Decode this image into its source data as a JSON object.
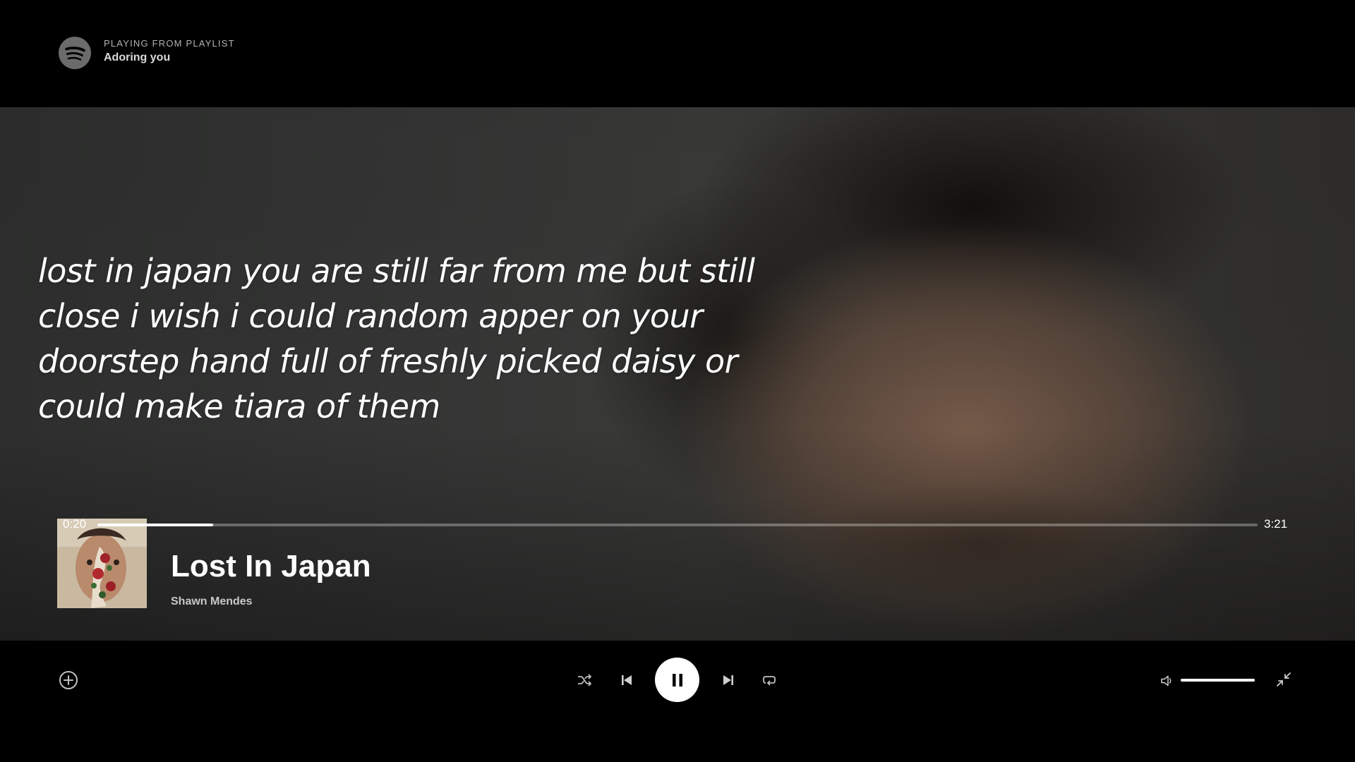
{
  "header": {
    "context_label": "PLAYING FROM PLAYLIST",
    "playlist_name": "Adoring you",
    "logo_icon": "spotify-logo-icon"
  },
  "lyrics": {
    "text": "lost in japan you are still far from me but still close i wish i could random apper on your doorstep hand full of freshly picked daisy or could make tiara of them"
  },
  "track": {
    "title": "Lost In Japan",
    "artist": "Shawn Mendes",
    "album_art_icon": "album-cover"
  },
  "progress": {
    "current": "0:20",
    "total": "3:21",
    "fraction": 0.1
  },
  "controls": {
    "add_icon": "plus-circle-icon",
    "shuffle_icon": "shuffle-icon",
    "previous_icon": "skip-previous-icon",
    "play_pause_icon": "pause-icon",
    "next_icon": "skip-next-icon",
    "repeat_icon": "repeat-icon",
    "volume_icon": "volume-icon",
    "volume_level": 1.0,
    "fullscreen_icon": "minimize-icon"
  },
  "colors": {
    "background": "#000000",
    "text_primary": "#ffffff",
    "text_secondary": "#b3b3b3"
  }
}
